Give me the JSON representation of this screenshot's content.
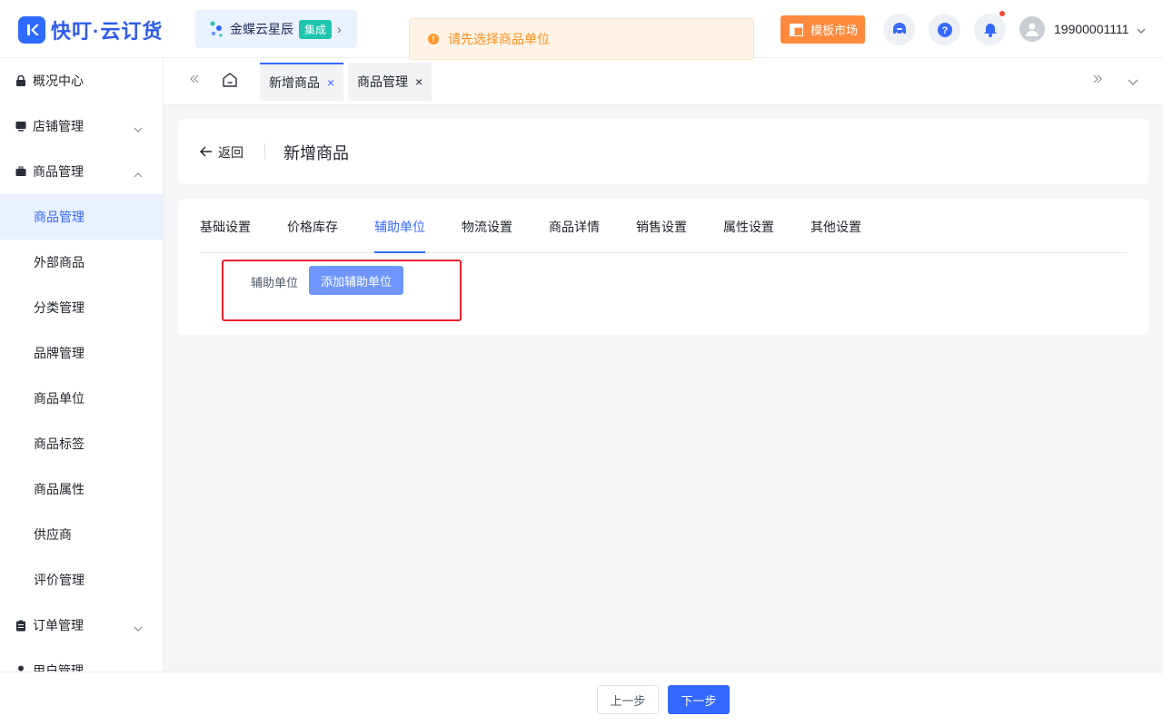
{
  "app": {
    "name": "快叮·云订货",
    "brand_color": "#2f6bff"
  },
  "header": {
    "integration": {
      "name": "金蝶云星辰",
      "badge": "集成"
    },
    "toast": {
      "message": "请先选择商品单位",
      "color": "#ff8f1f"
    },
    "market_button": "模板市场",
    "user": {
      "name": "19900001111"
    }
  },
  "sidebar": {
    "groups": [
      {
        "label": "概况中心",
        "icon": "lock-icon"
      },
      {
        "label": "店铺管理",
        "icon": "monitor-icon",
        "expanded": false
      },
      {
        "label": "商品管理",
        "icon": "briefcase-icon",
        "expanded": true,
        "children": [
          "商品管理",
          "外部商品",
          "分类管理",
          "品牌管理",
          "商品单位",
          "商品标签",
          "商品属性",
          "供应商",
          "评价管理"
        ],
        "active_child": "商品管理"
      },
      {
        "label": "订单管理",
        "icon": "clipboard-icon",
        "expanded": false
      },
      {
        "label": "用户管理",
        "icon": "user-icon",
        "expanded": false
      }
    ]
  },
  "page_tabs": [
    {
      "label": "新增商品",
      "active": true
    },
    {
      "label": "商品管理",
      "active": false
    }
  ],
  "page": {
    "back_label": "返回",
    "title": "新增商品",
    "tabs": [
      "基础设置",
      "价格库存",
      "辅助单位",
      "物流设置",
      "商品详情",
      "销售设置",
      "属性设置",
      "其他设置"
    ],
    "active_tab": "辅助单位",
    "aux_unit": {
      "label": "辅助单位",
      "button": "添加辅助单位"
    }
  },
  "footer": {
    "prev": "上一步",
    "next": "下一步"
  }
}
